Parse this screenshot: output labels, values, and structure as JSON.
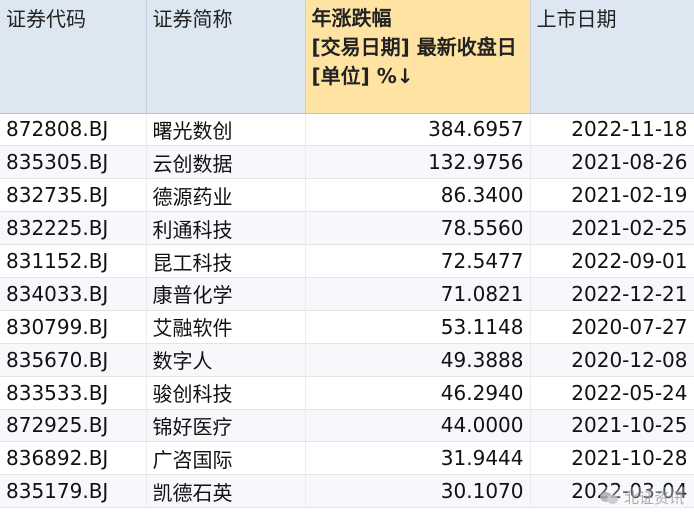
{
  "table": {
    "headers": {
      "code": "证券代码",
      "name": "证券简称",
      "change_line1": "年涨跌幅",
      "change_line2": "[交易日期] 最新收盘日",
      "change_line3": "[单位] %↓",
      "listing": "上市日期"
    },
    "rows": [
      {
        "code": "872808.BJ",
        "name": "曙光数创",
        "change": "384.6957",
        "listing": "2022-11-18"
      },
      {
        "code": "835305.BJ",
        "name": "云创数据",
        "change": "132.9756",
        "listing": "2021-08-26"
      },
      {
        "code": "832735.BJ",
        "name": "德源药业",
        "change": "86.3400",
        "listing": "2021-02-19"
      },
      {
        "code": "832225.BJ",
        "name": "利通科技",
        "change": "78.5560",
        "listing": "2021-02-25"
      },
      {
        "code": "831152.BJ",
        "name": "昆工科技",
        "change": "72.5477",
        "listing": "2022-09-01"
      },
      {
        "code": "834033.BJ",
        "name": "康普化学",
        "change": "71.0821",
        "listing": "2022-12-21"
      },
      {
        "code": "830799.BJ",
        "name": "艾融软件",
        "change": "53.1148",
        "listing": "2020-07-27"
      },
      {
        "code": "835670.BJ",
        "name": "数字人",
        "change": "49.3888",
        "listing": "2020-12-08"
      },
      {
        "code": "833533.BJ",
        "name": "骏创科技",
        "change": "46.2940",
        "listing": "2022-05-24"
      },
      {
        "code": "872925.BJ",
        "name": "锦好医疗",
        "change": "44.0000",
        "listing": "2021-10-25"
      },
      {
        "code": "836892.BJ",
        "name": "广咨国际",
        "change": "31.9444",
        "listing": "2021-10-28"
      },
      {
        "code": "835179.BJ",
        "name": "凯德石英",
        "change": "30.1070",
        "listing": "2022-03-04"
      }
    ]
  },
  "watermark": {
    "text": "北证资讯",
    "icon": "wechat-icon"
  }
}
